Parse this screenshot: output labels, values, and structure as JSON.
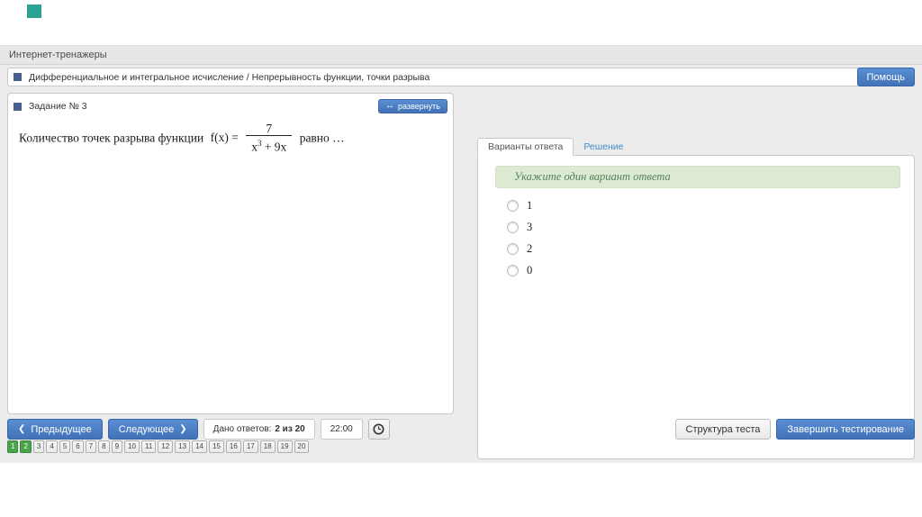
{
  "header": {
    "title": "Интернет-тренажеры"
  },
  "toolbar": {
    "breadcrumb": "Дифференциальное и интегральное исчисление / Непрерывность функции, точки разрыва",
    "help_label": "Помощь"
  },
  "task": {
    "title": "Задание № 3",
    "expand_label": "развернуть",
    "question_prefix": "Количество точек разрыва функции",
    "fx": "f(x) =",
    "fraction_numerator": "7",
    "fraction_denominator_base": "x",
    "fraction_denominator_sup": "3",
    "fraction_denominator_rest": " + 9x",
    "question_suffix": "равно …"
  },
  "answers": {
    "tabs": [
      {
        "label": "Варианты ответа",
        "active": true
      },
      {
        "label": "Решение",
        "active": false
      }
    ],
    "instruction": "Укажите один вариант ответа",
    "options": [
      "1",
      "3",
      "2",
      "0"
    ]
  },
  "footer": {
    "prev_label": "Предыдущее",
    "next_label": "Следующее",
    "answered_label": "Дано ответов:",
    "answered_value": "2 из 20",
    "timer": "22:00",
    "structure_label": "Структура теста",
    "finish_label": "Завершить тестирование"
  },
  "pagination": {
    "pages": [
      "1",
      "2",
      "3",
      "4",
      "5",
      "6",
      "7",
      "8",
      "9",
      "10",
      "11",
      "12",
      "13",
      "14",
      "15",
      "16",
      "17",
      "18",
      "19",
      "20"
    ],
    "answered": [
      "1",
      "2"
    ]
  },
  "icons": {
    "expand": "↔",
    "chevron_left": "❮",
    "chevron_right": "❯"
  },
  "colors": {
    "accent_blue": "#4674ba",
    "link_blue": "#428bca",
    "answered_green": "#4aa34a",
    "alert_bg": "#dcead3",
    "alert_text": "#567f58",
    "marker_teal": "#2ba393"
  }
}
